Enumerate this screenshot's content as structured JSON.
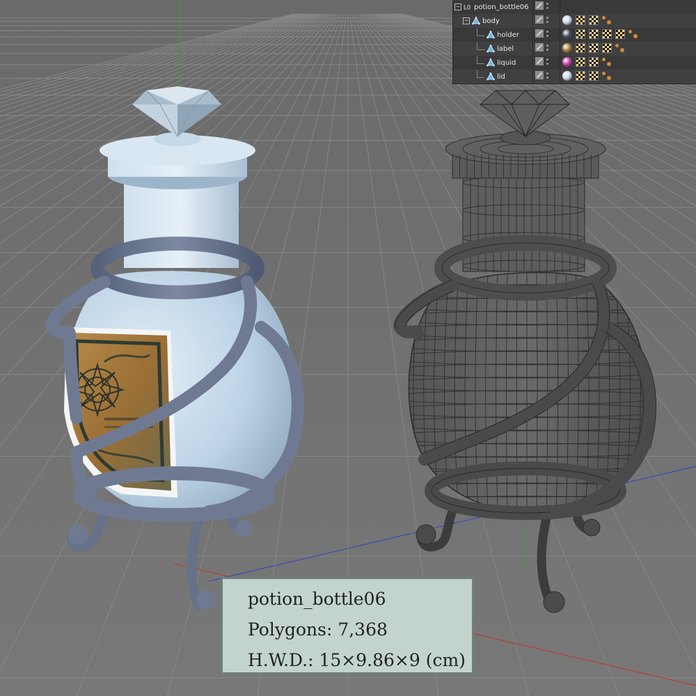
{
  "app": {
    "window": "Cinema 4D viewport render",
    "viewport": {
      "background_color": "#6f6f6f",
      "grid_color": "#8a8a8a",
      "axis_colors": {
        "x": "#c0392b",
        "y": "#3f9a3f",
        "z": "#3a4fb0"
      }
    }
  },
  "object_manager": {
    "rows": [
      {
        "name": "potion_bottle06",
        "type": "null",
        "expander": "−",
        "icon": "null-object-icon",
        "tags": []
      },
      {
        "name": "body",
        "type": "poly",
        "expander": "−",
        "icon": "polygon-object-icon",
        "tags": [
          "material-light",
          "uv",
          "uv",
          "phong"
        ]
      },
      {
        "name": "holder",
        "type": "poly",
        "expander": "",
        "icon": "polygon-object-icon",
        "tags": [
          "material-dark",
          "uv",
          "uv",
          "uv",
          "uv",
          "phong"
        ]
      },
      {
        "name": "label",
        "type": "poly",
        "expander": "",
        "icon": "polygon-object-icon",
        "tags": [
          "material-label",
          "uv",
          "uv",
          "uv",
          "phong"
        ]
      },
      {
        "name": "liquid",
        "type": "poly",
        "expander": "",
        "icon": "polygon-object-icon",
        "tags": [
          "material-pink",
          "uv",
          "uv",
          "phong"
        ]
      },
      {
        "name": "lid",
        "type": "poly",
        "expander": "",
        "icon": "polygon-object-icon",
        "tags": [
          "material-light",
          "uv",
          "uv",
          "phong"
        ]
      }
    ],
    "material_colors": {
      "material-light": "#c8d8e6",
      "material-dark": "#4b5268",
      "material-label": "#a67c3a",
      "material-pink": "#c93aa8"
    }
  },
  "info_card": {
    "name": "potion_bottle06",
    "polygons": "Polygons: 7,368",
    "dimensions": "H.W.D.: 15×9.86×9 (cm)"
  },
  "model": {
    "shaded_colors": {
      "body": "#bcd3e6",
      "holder": "#6f7a92",
      "label_bg": "#a77a3e",
      "label_frame": "#2f3a32"
    },
    "wire_colors": {
      "fill": "#5c5c5c",
      "line": "#2b2b2b"
    }
  }
}
